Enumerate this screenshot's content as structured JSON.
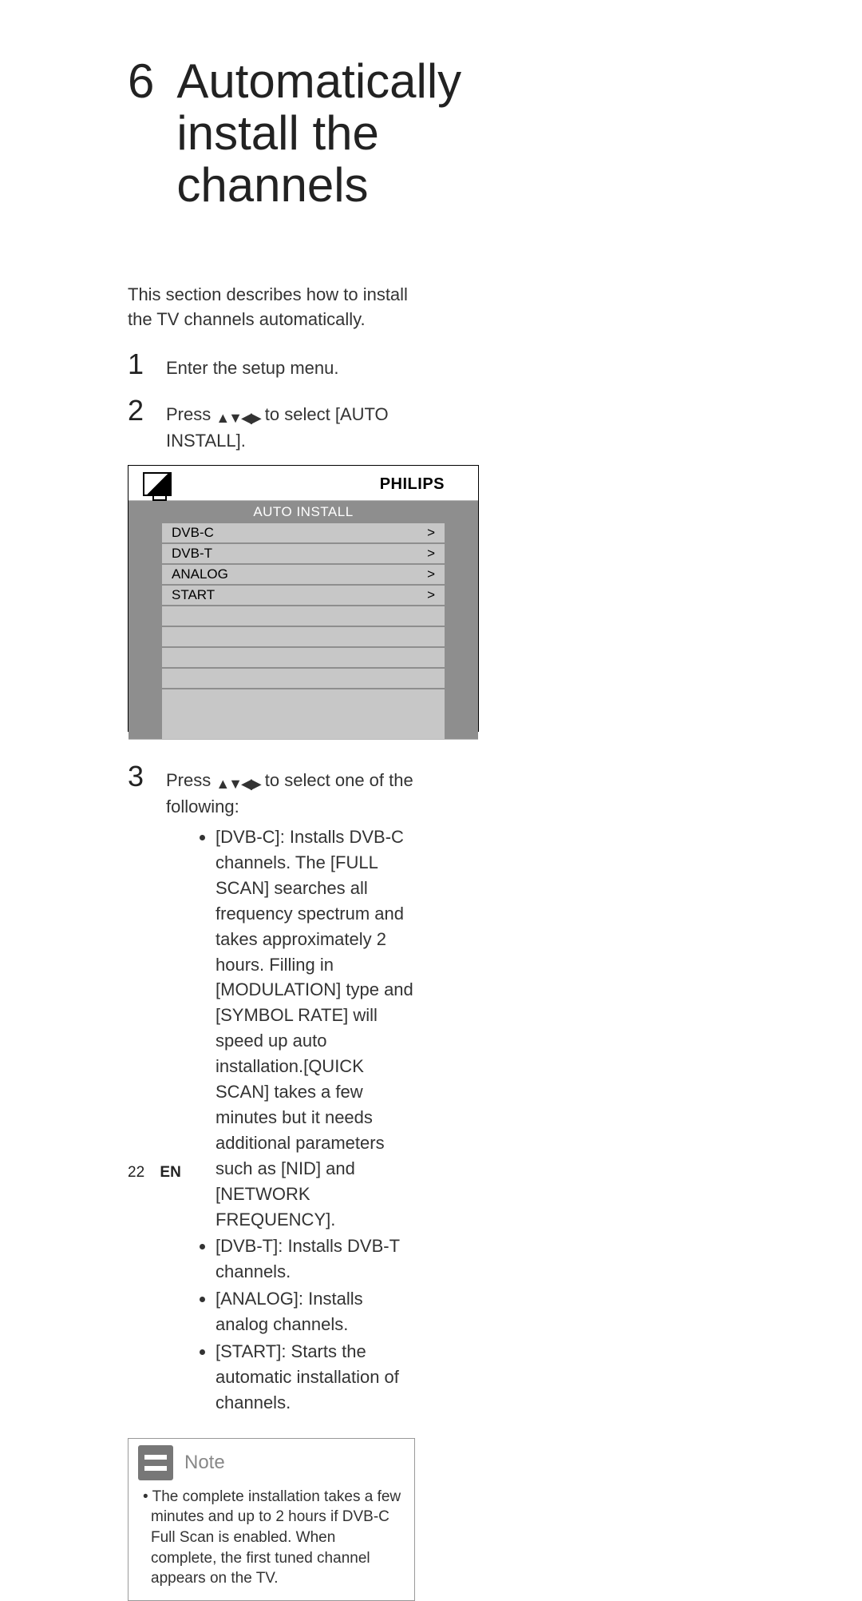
{
  "chapter": {
    "number": "6",
    "title": "Automatically install the channels"
  },
  "intro": "This section describes how to install the TV channels automatically.",
  "steps": {
    "s1": "Enter the setup menu.",
    "s2_pre": "Press ",
    "s2_post": " to select ",
    "s2_target": "[AUTO INSTALL]",
    "s2_end": ".",
    "s3_pre": "Press ",
    "s3_post": " to select one of the following:"
  },
  "tv_menu": {
    "brand": "PHILIPS",
    "title": "AUTO INSTALL",
    "rows": [
      {
        "label": "DVB-C",
        "arrow": ">"
      },
      {
        "label": "DVB-T",
        "arrow": ">"
      },
      {
        "label": "ANALOG",
        "arrow": ">"
      },
      {
        "label": "START",
        "arrow": ">"
      }
    ]
  },
  "options": {
    "dvbc_label": "[DVB-C]",
    "dvbc_desc1": ": Installs DVB-C channels. The ",
    "dvbc_fullscan": "[FULL SCAN]",
    "dvbc_desc2": " searches all frequency spectrum and takes approximately 2 hours. Filling in ",
    "dvbc_mod": "[MODULATION]",
    "dvbc_desc3": " type and ",
    "dvbc_sym": "[SYMBOL RATE]",
    "dvbc_desc4": " will speed up auto installation.",
    "dvbc_quick": "[QUICK SCAN]",
    "dvbc_desc5": " takes a few minutes but it needs additional parameters such as ",
    "dvbc_nid": "[NID]",
    "dvbc_and": " and ",
    "dvbc_net": "[NETWORK FREQUENCY]",
    "dvbc_end": ".",
    "dvbt_label": "[DVB-T]",
    "dvbt_desc": ": Installs DVB-T channels.",
    "analog_label": "[ANALOG]",
    "analog_desc": ": Installs analog channels.",
    "start_label": "[START]",
    "start_desc": ": Starts the automatic installation of channels."
  },
  "note": {
    "heading": "Note",
    "bullet": "•",
    "body": "The complete installation takes a few minutes and up to 2 hours if DVB-C Full Scan is enabled. When complete, the first tuned channel appears on the TV."
  },
  "footer": {
    "page": "22",
    "lang": "EN"
  }
}
